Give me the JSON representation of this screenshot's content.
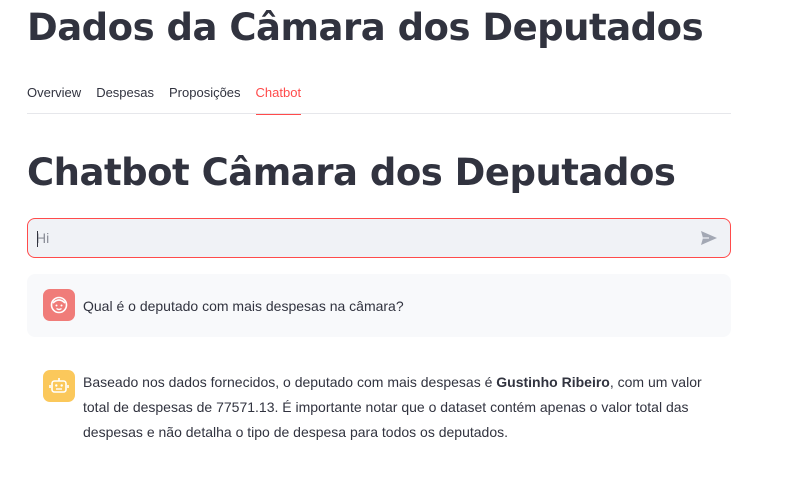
{
  "app": {
    "title": "Dados da Câmara dos Deputados"
  },
  "tabs": [
    {
      "label": "Overview",
      "active": false
    },
    {
      "label": "Despesas",
      "active": false
    },
    {
      "label": "Proposições",
      "active": false
    },
    {
      "label": "Chatbot",
      "active": true
    }
  ],
  "page": {
    "heading": "Chatbot Câmara dos Deputados"
  },
  "chat_input": {
    "value": "",
    "placeholder": "Hi",
    "send_icon": "send-arrow-icon"
  },
  "messages": [
    {
      "role": "user",
      "avatar_icon": "user-face-icon",
      "text": "Qual é o deputado com mais despesas na câmara?"
    },
    {
      "role": "assistant",
      "avatar_icon": "robot-icon",
      "text_before": "Baseado nos dados fornecidos, o deputado com mais despesas é ",
      "text_bold": "Gustinho Ribeiro",
      "text_after": ", com um valor total de despesas de 77571.13. É importante notar que o dataset contém apenas o valor total das despesas e não detalha o tipo de despesa para todos os deputados."
    }
  ],
  "colors": {
    "accent": "#ff4b4b",
    "text": "#31333f",
    "input_bg": "#f0f2f6",
    "user_avatar": "#f07c79",
    "assistant_avatar": "#fbc85b"
  }
}
